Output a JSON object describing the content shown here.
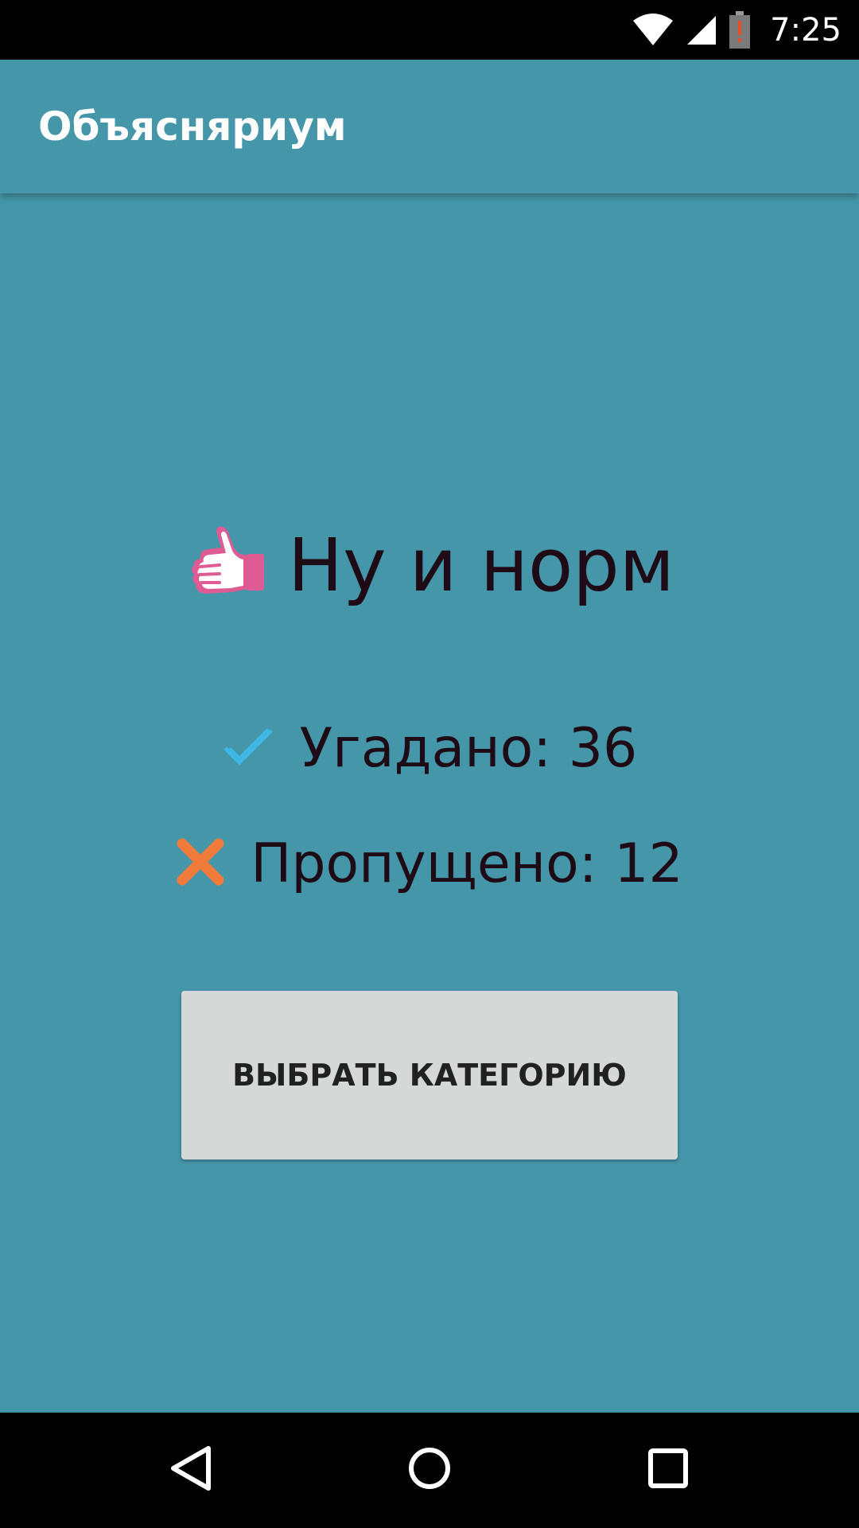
{
  "status_bar": {
    "time": "7:25",
    "icons": [
      "wifi-icon",
      "cell-signal-icon",
      "battery-alert-icon"
    ]
  },
  "app_bar": {
    "title": "Объясняриум"
  },
  "result": {
    "icon": "thumbs-up-icon",
    "text": "Ну и норм"
  },
  "stats": {
    "guessed": {
      "icon": "check-icon",
      "label": "Угадано: 36",
      "color": "#3fb8e8"
    },
    "skipped": {
      "icon": "cross-icon",
      "label": "Пропущено: 12",
      "color": "#f07a3a"
    }
  },
  "button": {
    "label": "ВЫБРАТЬ КАТЕГОРИЮ"
  },
  "nav_bar": {
    "buttons": [
      "back-icon",
      "home-icon",
      "recents-icon"
    ]
  },
  "colors": {
    "background": "#4496a8",
    "button_bg": "#d6d7d7",
    "text_dark": "#1e0b15",
    "accent_pink": "#de5b93"
  }
}
